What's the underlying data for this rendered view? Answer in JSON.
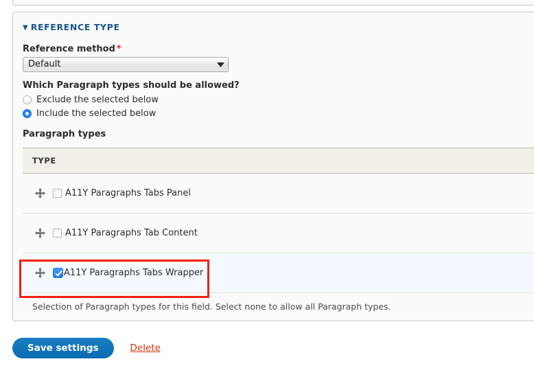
{
  "panel": {
    "summary_title": "REFERENCE TYPE",
    "disclosure_glyph": "▼"
  },
  "reference_method": {
    "label": "Reference method",
    "required_marker": "*",
    "selected": "Default",
    "options": [
      "Default"
    ]
  },
  "allowed_question": {
    "label": "Which Paragraph types should be allowed?",
    "options": [
      {
        "label": "Exclude the selected below",
        "checked": false
      },
      {
        "label": "Include the selected below",
        "checked": true
      }
    ]
  },
  "paragraph_types": {
    "section_label": "Paragraph types",
    "column_header": "TYPE",
    "rows": [
      {
        "label": "A11Y Paragraphs Tabs Panel",
        "checked": false,
        "highlighted": false
      },
      {
        "label": "A11Y Paragraphs Tab Content",
        "checked": false,
        "highlighted": false
      },
      {
        "label": "A11Y Paragraphs Tabs Wrapper",
        "checked": true,
        "highlighted": true
      }
    ],
    "help_text": "Selection of Paragraph types for this field. Select none to allow all Paragraph types."
  },
  "actions": {
    "save_label": "Save settings",
    "delete_label": "Delete"
  },
  "colors": {
    "accent_blue": "#0a6bb0",
    "heading_blue": "#15568c",
    "delete_red": "#d8360a",
    "annotation_red": "#f32013",
    "selected_row_bg": "#f4faff",
    "table_header_bg": "#f1f1e9",
    "panel_bg": "#fbfbf9"
  }
}
